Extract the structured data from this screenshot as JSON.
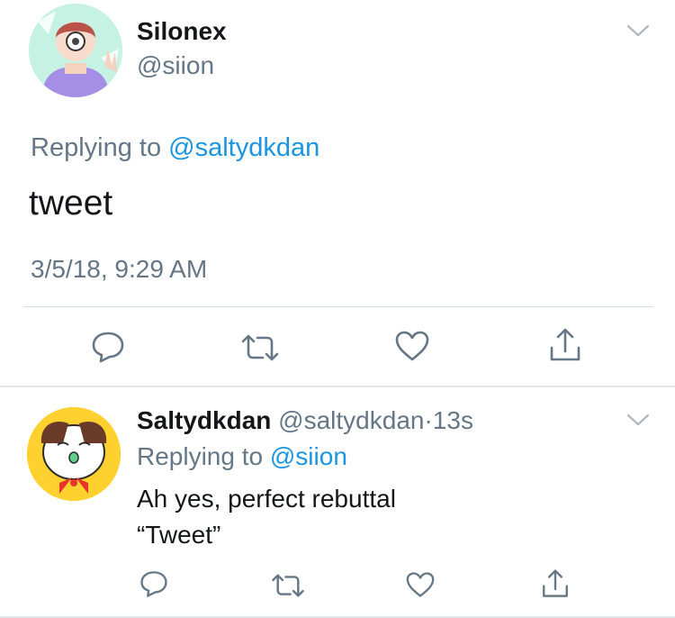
{
  "main_tweet": {
    "author": {
      "name": "Silonex",
      "handle": "@siion"
    },
    "replying_prefix": "Replying to",
    "replying_to": "@saltydkdan",
    "text": "tweet",
    "timestamp": "3/5/18, 9:29 AM",
    "actions": [
      "reply-icon",
      "retweet-icon",
      "like-icon",
      "share-icon"
    ]
  },
  "reply_tweet": {
    "author": {
      "name": "Saltydkdan",
      "handle": "@saltydkdan"
    },
    "separator": "·",
    "age": "13s",
    "replying_prefix": "Replying to",
    "replying_to": "@siion",
    "text_line1": "Ah yes, perfect rebuttal",
    "text_line2": "“Tweet”",
    "actions": [
      "reply-icon",
      "retweet-icon",
      "like-icon",
      "share-icon"
    ]
  },
  "colors": {
    "text": "#14171a",
    "secondary": "#657786",
    "link": "#1b95e0",
    "divider": "#e1e6ea"
  }
}
